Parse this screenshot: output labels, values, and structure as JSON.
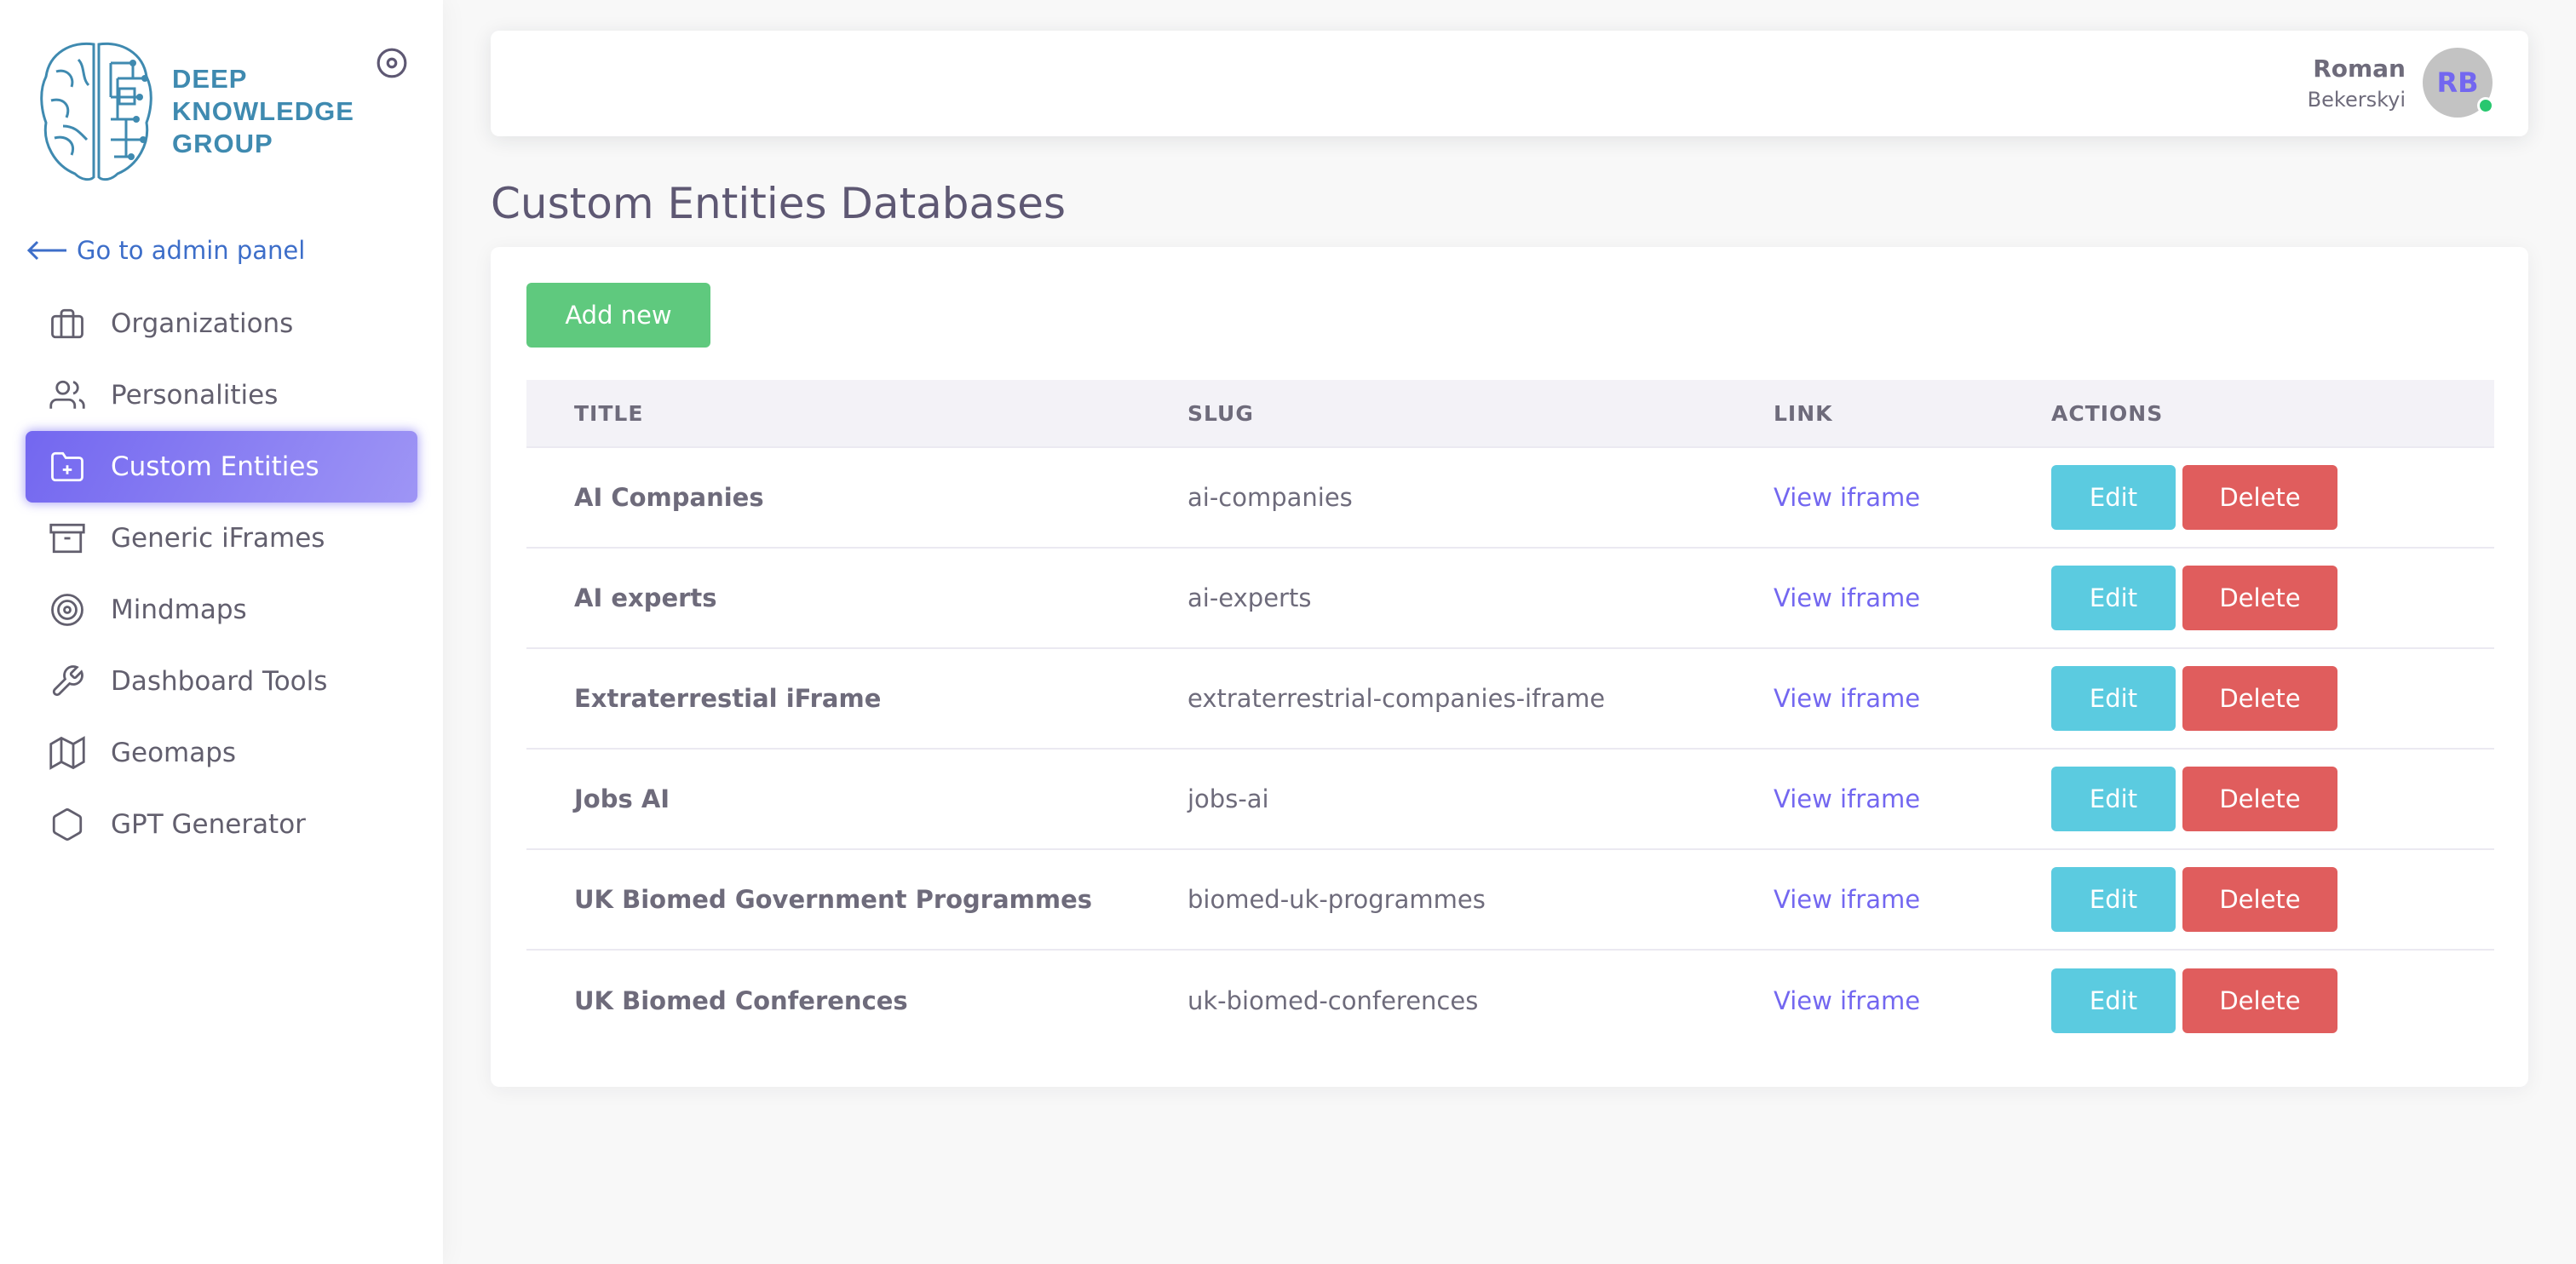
{
  "brand": {
    "lines": [
      "DEEP",
      "KNOWLEDGE",
      "GROUP"
    ]
  },
  "sidebar": {
    "admin_link": "Go to admin panel",
    "items": [
      {
        "label": "Organizations",
        "icon": "briefcase-icon"
      },
      {
        "label": "Personalities",
        "icon": "users-icon"
      },
      {
        "label": "Custom Entities",
        "icon": "folder-plus-icon",
        "active": true
      },
      {
        "label": "Generic iFrames",
        "icon": "archive-icon"
      },
      {
        "label": "Mindmaps",
        "icon": "target-icon"
      },
      {
        "label": "Dashboard Tools",
        "icon": "tool-icon"
      },
      {
        "label": "Geomaps",
        "icon": "map-icon"
      },
      {
        "label": "GPT Generator",
        "icon": "hexagon-icon"
      }
    ]
  },
  "header": {
    "user_name": "Roman",
    "user_subtitle": "Bekerskyi",
    "avatar_initials": "RB",
    "status_color": "#28c76f"
  },
  "page": {
    "title": "Custom Entities Databases"
  },
  "toolbar": {
    "add_label": "Add new"
  },
  "table": {
    "columns": [
      "TITLE",
      "SLUG",
      "LINK",
      "ACTIONS"
    ],
    "rows": [
      {
        "title": "AI Companies",
        "slug": "ai-companies",
        "link": "View iframe",
        "edit": "Edit",
        "delete": "Delete"
      },
      {
        "title": "AI experts",
        "slug": "ai-experts",
        "link": "View iframe",
        "edit": "Edit",
        "delete": "Delete"
      },
      {
        "title": "Extraterrestial iFrame",
        "slug": "extraterrestrial-companies-iframe",
        "link": "View iframe",
        "edit": "Edit",
        "delete": "Delete"
      },
      {
        "title": "Jobs AI",
        "slug": "jobs-ai",
        "link": "View iframe",
        "edit": "Edit",
        "delete": "Delete"
      },
      {
        "title": "UK Biomed Government Programmes",
        "slug": "biomed-uk-programmes",
        "link": "View iframe",
        "edit": "Edit",
        "delete": "Delete"
      },
      {
        "title": "UK Biomed Conferences",
        "slug": "uk-biomed-conferences",
        "link": "View iframe",
        "edit": "Edit",
        "delete": "Delete"
      }
    ]
  },
  "colors": {
    "accent": "#7367f0",
    "add_button": "#5fc97e",
    "edit_button": "#5bcbe0",
    "delete_button": "#e05d5d",
    "logo": "#3f8ab0"
  }
}
